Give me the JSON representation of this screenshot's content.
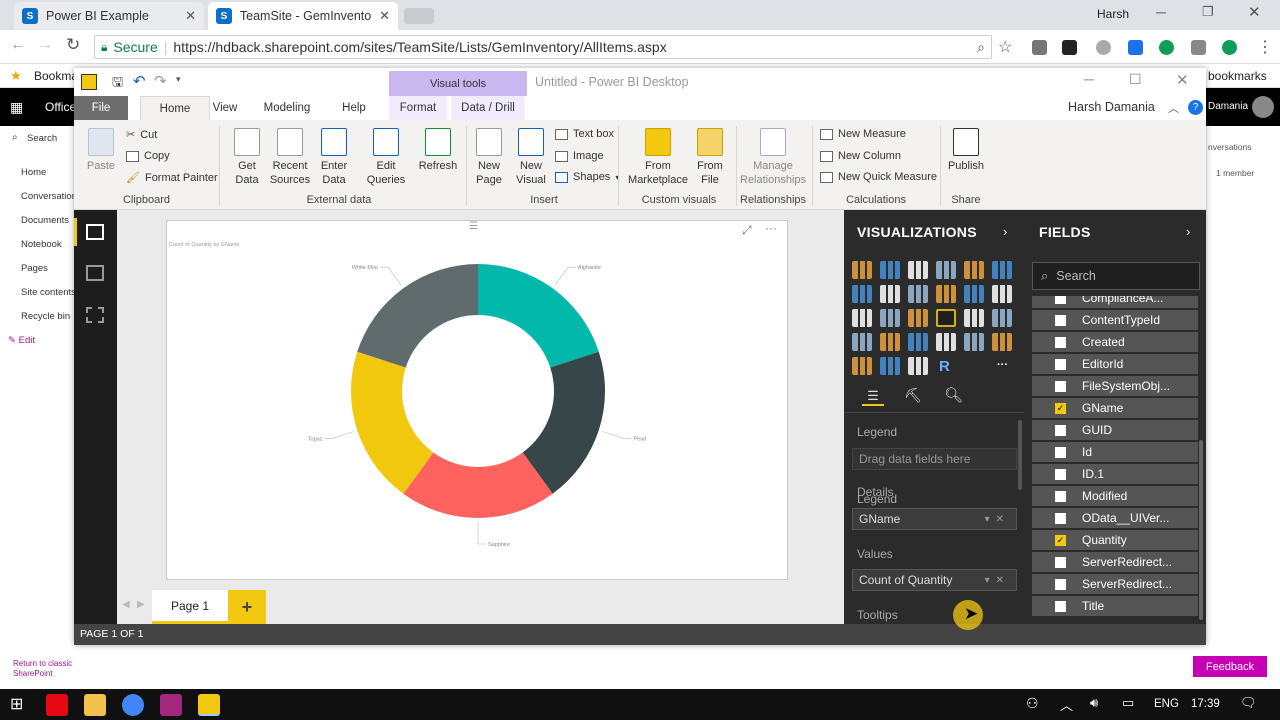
{
  "browser": {
    "tabs": [
      {
        "title": "Power BI Example"
      },
      {
        "title": "TeamSite - GemInventor"
      }
    ],
    "user": "Harsh",
    "secure_label": "Secure",
    "url": "https://hdback.sharepoint.com/sites/TeamSite/Lists/GemInventory/AllItems.aspx",
    "bookmarks_left": "Bookma",
    "bookmarks_right": "bookmarks"
  },
  "sharepoint": {
    "office_label": "Office",
    "user_short": "Damania",
    "search_label": "Search",
    "nav": [
      "Home",
      "Conversation",
      "Documents",
      "Notebook",
      "Pages",
      "Site contents",
      "Recycle bin"
    ],
    "edit_label": "Edit",
    "right_snippets": [
      "nversations",
      "1 member"
    ],
    "return_classic": "Return to classic SharePoint",
    "feedback": "Feedback"
  },
  "powerbi": {
    "window_title": "Untitled - Power BI Desktop",
    "context_tab": "Visual tools",
    "menu_tabs": [
      "File",
      "Home",
      "View",
      "Modeling",
      "Help",
      "Format",
      "Data / Drill"
    ],
    "user_name": "Harsh Damania",
    "ribbon": {
      "clipboard": {
        "paste": "Paste",
        "cut": "Cut",
        "copy": "Copy",
        "format_painter": "Format Painter",
        "group": "Clipboard"
      },
      "external": {
        "get_data": "Get Data",
        "recent": "Recent Sources",
        "enter": "Enter Data",
        "edit": "Edit Queries",
        "refresh": "Refresh",
        "group": "External data"
      },
      "insert": {
        "new_page": "New Page",
        "new_visual": "New Visual",
        "text_box": "Text box",
        "image": "Image",
        "shapes": "Shapes",
        "group": "Insert"
      },
      "custom": {
        "marketplace": "From Marketplace",
        "file": "From File",
        "group": "Custom visuals"
      },
      "relationships": {
        "manage": "Manage Relationships",
        "group": "Relationships"
      },
      "calculations": {
        "measure": "New Measure",
        "column": "New Column",
        "quick": "New Quick Measure",
        "group": "Calculations"
      },
      "share": {
        "publish": "Publish",
        "group": "Share"
      }
    },
    "page_tab": "Page 1",
    "status": "PAGE 1 OF 1"
  },
  "visualizations": {
    "title": "VISUALIZATIONS",
    "legend_label": "Legend",
    "legend_placeholder": "Drag data fields here",
    "details_label": "Details",
    "details_value": "GName",
    "values_label": "Values",
    "values_value": "Count of Quantity",
    "tooltips_label": "Tooltips",
    "more": "···",
    "r_glyph": "R"
  },
  "fields": {
    "title": "FIELDS",
    "search_placeholder": "Search",
    "items": [
      {
        "name": "ComplianceA...",
        "checked": false
      },
      {
        "name": "ContentTypeId",
        "checked": false
      },
      {
        "name": "Created",
        "checked": false
      },
      {
        "name": "EditorId",
        "checked": false
      },
      {
        "name": "FileSystemObj...",
        "checked": false
      },
      {
        "name": "GName",
        "checked": true
      },
      {
        "name": "GUID",
        "checked": false
      },
      {
        "name": "Id",
        "checked": false
      },
      {
        "name": "ID.1",
        "checked": false
      },
      {
        "name": "Modified",
        "checked": false
      },
      {
        "name": "OData__UIVer...",
        "checked": false
      },
      {
        "name": "Quantity",
        "checked": true
      },
      {
        "name": "ServerRedirect...",
        "checked": false
      },
      {
        "name": "ServerRedirect...",
        "checked": false
      },
      {
        "name": "Title",
        "checked": false
      }
    ]
  },
  "chart_data": {
    "type": "pie",
    "subtype": "donut",
    "title": "Count of Quantity by GName",
    "categories": [
      "Alghanite",
      "Pearl",
      "Sapphire",
      "Topaz",
      "White Moo"
    ],
    "values": [
      1,
      1,
      1,
      1,
      1
    ],
    "colors": [
      "#01b8aa",
      "#374649",
      "#fd625e",
      "#f2c80f",
      "#5f6b6d"
    ]
  },
  "taskbar": {
    "lang": "ENG",
    "time": "17:39"
  }
}
